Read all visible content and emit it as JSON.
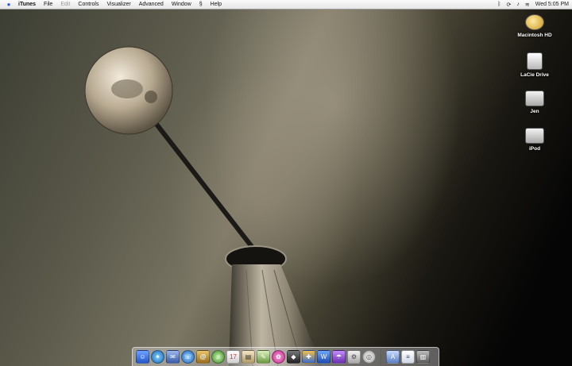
{
  "menubar": {
    "app_name": "iTunes",
    "items": [
      "File",
      "Edit",
      "Controls",
      "Visualizer",
      "Advanced",
      "Window",
      "Help"
    ],
    "clock": "Wed 5:05 PM"
  },
  "desktop": {
    "drives": [
      "Macintosh HD",
      "LaCie Drive",
      "Jen",
      "iPod"
    ]
  },
  "colors": {
    "menubar_bg": "#eeeeee",
    "apple_blue": "#2a5bd7",
    "dock_glass": "#e1e1e6"
  }
}
